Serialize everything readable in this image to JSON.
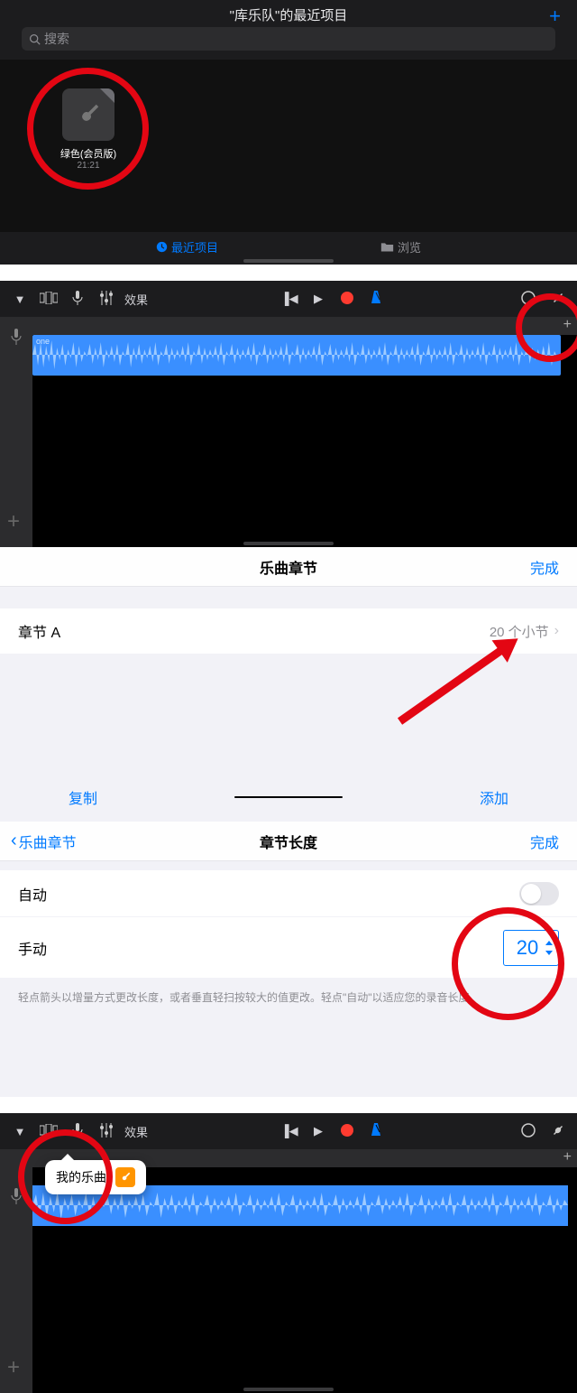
{
  "library": {
    "title": "\"库乐队\"的最近项目",
    "search_placeholder": "搜索",
    "item": {
      "name": "绿色(会员版)",
      "time": "21:21"
    },
    "tab_recent": "最近项目",
    "tab_browse": "浏览"
  },
  "editor": {
    "fx_label": "效果",
    "track_label": "one"
  },
  "sections": {
    "title": "乐曲章节",
    "done": "完成",
    "row_label": "章节 A",
    "row_value": "20 个小节",
    "copy": "复制",
    "add": "添加"
  },
  "length": {
    "back": "乐曲章节",
    "title": "章节长度",
    "done": "完成",
    "auto_label": "自动",
    "manual_label": "手动",
    "manual_value": "20",
    "hint": "轻点箭头以增量方式更改长度，或者垂直轻扫按较大的值更改。轻点\"自动\"以适应您的录音长度。"
  },
  "menu": {
    "my_songs": "我的乐曲"
  }
}
